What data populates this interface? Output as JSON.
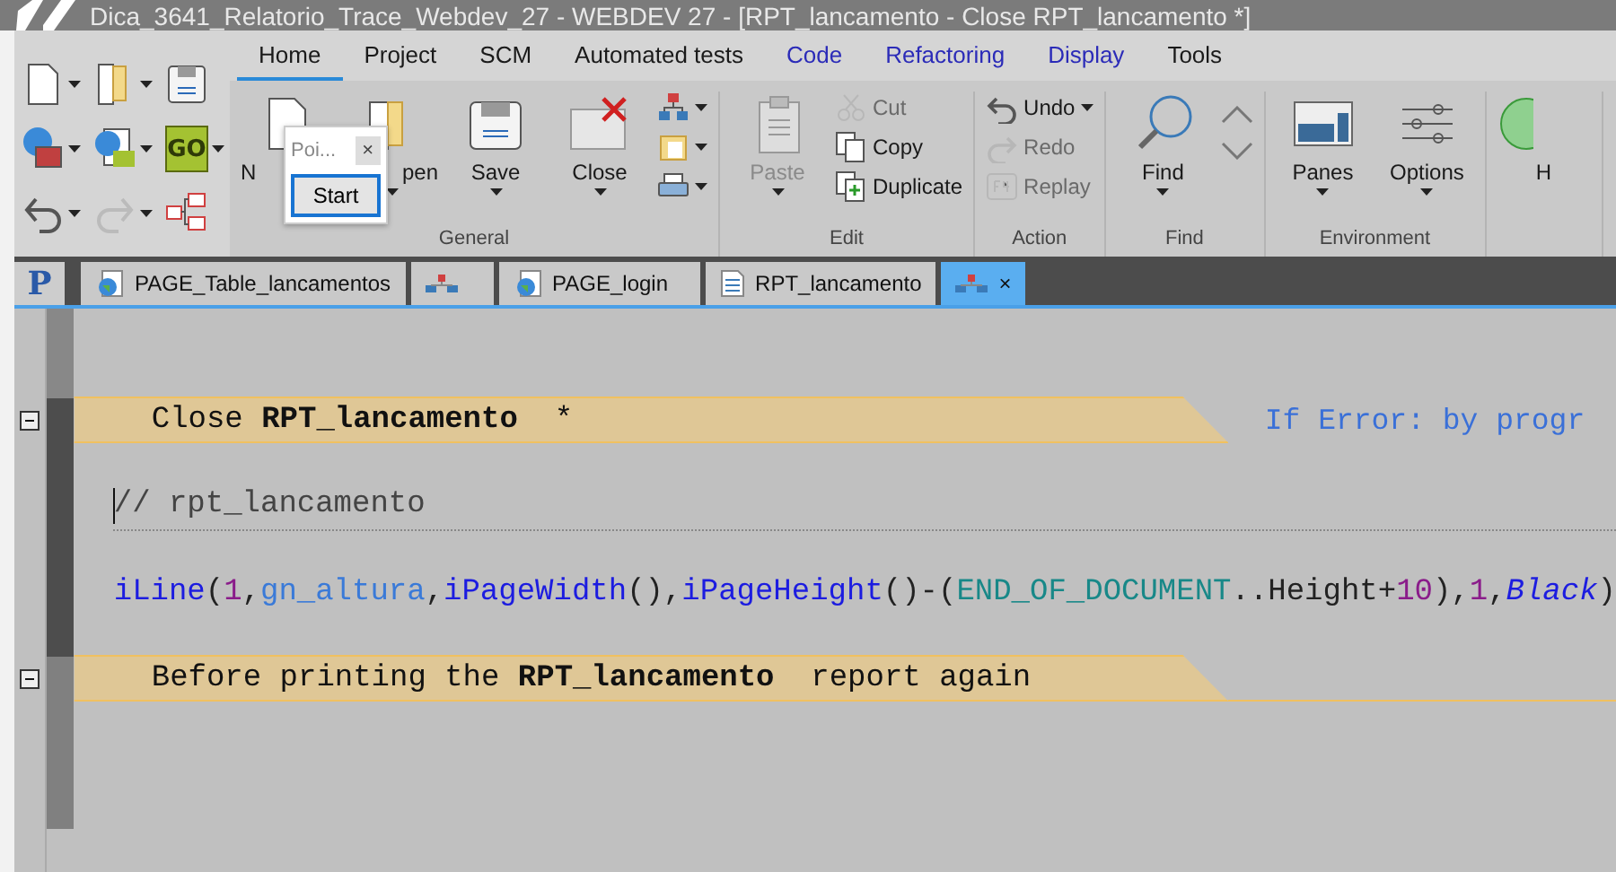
{
  "window": {
    "title": "Dica_3641_Relatorio_Trace_Webdev_27 - WEBDEV 27 - [RPT_lancamento - Close RPT_lancamento *]"
  },
  "quick_access": [
    {
      "dropdown": true
    },
    {
      "dropdown": true
    },
    {
      "dropdown": false
    },
    {
      "dropdown": true
    },
    {
      "dropdown": true
    },
    {
      "label": "GO",
      "dropdown": true
    },
    {
      "dropdown": true,
      "disabled": false
    },
    {
      "dropdown": true,
      "disabled": true
    },
    {
      "dropdown": false
    }
  ],
  "ribbon_tabs": [
    {
      "label": "Home",
      "selected": true,
      "color": "#1a1a1a"
    },
    {
      "label": "Project",
      "selected": false,
      "color": "#1a1a1a"
    },
    {
      "label": "SCM",
      "selected": false,
      "color": "#1a1a1a"
    },
    {
      "label": "Automated tests",
      "selected": false,
      "color": "#1a1a1a"
    },
    {
      "label": "Code",
      "selected": false,
      "color": "#2b2bb8"
    },
    {
      "label": "Refactoring",
      "selected": false,
      "color": "#2b2bb8"
    },
    {
      "label": "Display",
      "selected": false,
      "color": "#2b2bb8"
    },
    {
      "label": "Tools",
      "selected": false,
      "color": "#1a1a1a"
    }
  ],
  "ribbon_groups": [
    {
      "label": "General",
      "columns": [
        {
          "kind": "big",
          "label": "N",
          "dropdown": false,
          "disabled": false
        },
        {
          "kind": "big",
          "label": "pen",
          "dropdown": true,
          "disabled": false
        },
        {
          "kind": "big",
          "label": "Save",
          "dropdown": true,
          "disabled": false
        },
        {
          "kind": "big",
          "label": "Close",
          "dropdown": true,
          "disabled": false
        },
        {
          "kind": "stack",
          "items": [
            {
              "dropdown": true,
              "disabled": false
            },
            {
              "dropdown": true,
              "disabled": false
            },
            {
              "dropdown": true,
              "disabled": false
            }
          ]
        }
      ]
    },
    {
      "label": "Edit",
      "columns": [
        {
          "kind": "big",
          "label": "Paste",
          "dropdown": true,
          "disabled": true
        },
        {
          "kind": "stack",
          "items": [
            {
              "label": "Cut",
              "dropdown": false,
              "disabled": true
            },
            {
              "label": "Copy",
              "dropdown": false,
              "disabled": false
            },
            {
              "label": "Duplicate",
              "dropdown": false,
              "disabled": false
            }
          ]
        }
      ]
    },
    {
      "label": "Action",
      "columns": [
        {
          "kind": "stack",
          "items": [
            {
              "label": "Undo",
              "dropdown": true,
              "disabled": false
            },
            {
              "label": "Redo",
              "dropdown": false,
              "disabled": true
            },
            {
              "label": "Replay",
              "dropdown": false,
              "disabled": true
            }
          ]
        }
      ]
    },
    {
      "label": "Find",
      "columns": [
        {
          "kind": "big",
          "label": "Find",
          "dropdown": true,
          "disabled": false
        },
        {
          "kind": "arrows"
        }
      ]
    },
    {
      "label": "Environment",
      "columns": [
        {
          "kind": "big",
          "label": "Panes",
          "dropdown": true,
          "disabled": false
        },
        {
          "kind": "big",
          "label": "Options",
          "dropdown": true,
          "disabled": false
        }
      ]
    },
    {
      "columns": [
        {
          "kind": "big",
          "label": "H",
          "dropdown": false,
          "disabled": false
        }
      ]
    }
  ],
  "popup": {
    "title": "Poi...",
    "close": "×",
    "button": "Start"
  },
  "project_button": "P",
  "doc_tabs": [
    {
      "label": "PAGE_Table_lancamentos",
      "kind": "page",
      "selected": false
    },
    {
      "kind": "diagram",
      "selected": false
    },
    {
      "label": "PAGE_login",
      "kind": "page",
      "selected": false
    },
    {
      "label": "RPT_lancamento",
      "kind": "report",
      "selected": false
    },
    {
      "kind": "diagram",
      "selected": true,
      "close": "×"
    }
  ],
  "editor": {
    "lines": [
      {
        "kind": "header",
        "text": "Close **RPT_lancamento**  *",
        "note": "If Error: by progr",
        "expanded": true
      },
      {
        "kind": "comment",
        "text": "// rpt_lancamento",
        "cursor": true
      },
      {
        "kind": "code",
        "tokens": [
          {
            "kind": "func",
            "text": "iLine"
          },
          {
            "kind": "plain",
            "text": "("
          },
          {
            "kind": "number",
            "text": "1"
          },
          {
            "kind": "plain",
            "text": ","
          },
          {
            "kind": "var",
            "text": "gn_altura"
          },
          {
            "kind": "plain",
            "text": ","
          },
          {
            "kind": "func",
            "text": "iPageWidth"
          },
          {
            "kind": "plain",
            "text": "(),"
          },
          {
            "kind": "func",
            "text": "iPageHeight"
          },
          {
            "kind": "plain",
            "text": "()-("
          },
          {
            "kind": "const",
            "text": "END_OF_DOCUMENT"
          },
          {
            "kind": "plain",
            "text": "..Height+"
          },
          {
            "kind": "number",
            "text": "10"
          },
          {
            "kind": "plain",
            "text": "),"
          },
          {
            "kind": "number",
            "text": "1"
          },
          {
            "kind": "plain",
            "text": ","
          },
          {
            "kind": "italic",
            "text": "Black"
          },
          {
            "kind": "plain",
            "text": ")"
          }
        ]
      },
      {
        "kind": "header",
        "text": "Before printing the **RPT_lancamento**  report again",
        "expanded": true
      }
    ]
  }
}
